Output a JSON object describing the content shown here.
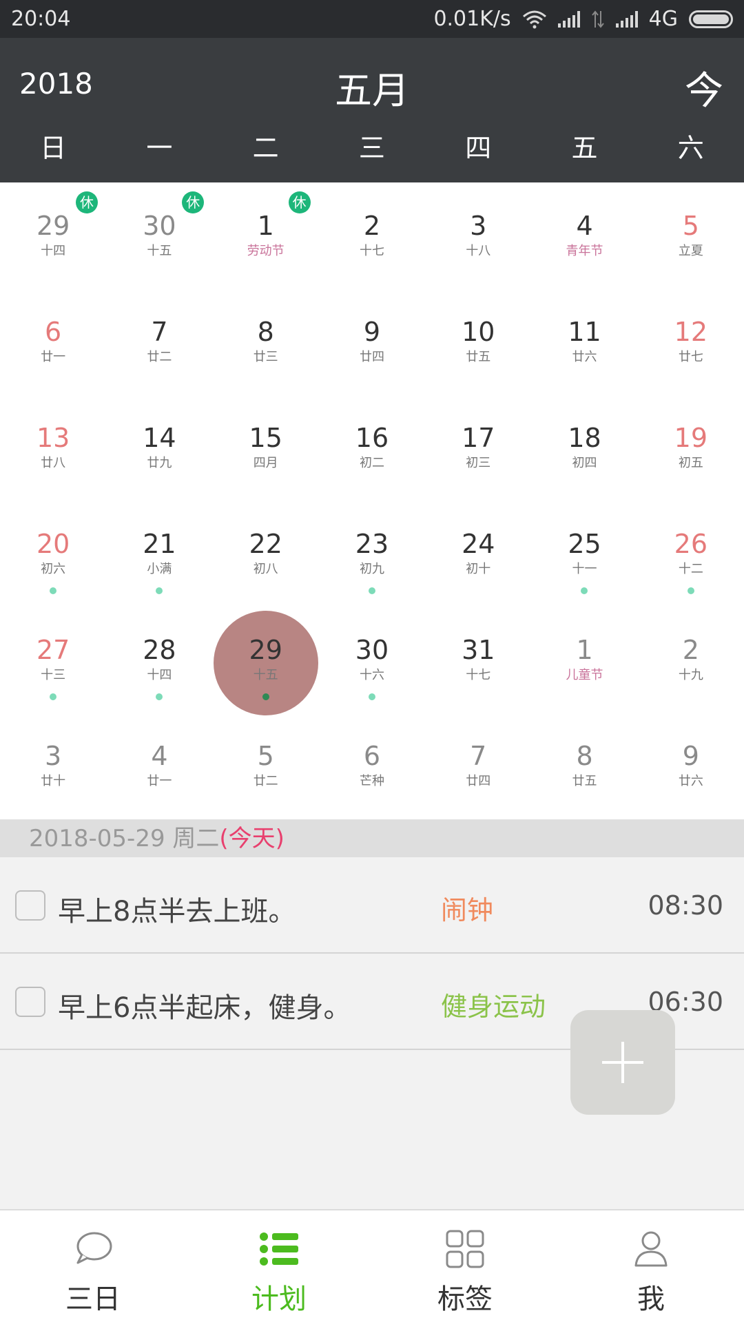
{
  "status_bar": {
    "time": "20:04",
    "speed": "0.01K/s",
    "network": "4G"
  },
  "header": {
    "year": "2018",
    "month": "五月",
    "today_button": "今",
    "weekdays": [
      "日",
      "一",
      "二",
      "三",
      "四",
      "五",
      "六"
    ]
  },
  "rest_label": "休",
  "calendar": [
    [
      {
        "day": "29",
        "lunar": "十四",
        "other": true,
        "rest": true
      },
      {
        "day": "30",
        "lunar": "十五",
        "other": true,
        "rest": true
      },
      {
        "day": "1",
        "lunar": "劳动节",
        "holiday": true,
        "rest": true
      },
      {
        "day": "2",
        "lunar": "十七"
      },
      {
        "day": "3",
        "lunar": "十八"
      },
      {
        "day": "4",
        "lunar": "青年节",
        "holiday": true
      },
      {
        "day": "5",
        "lunar": "立夏",
        "weekend": true
      }
    ],
    [
      {
        "day": "6",
        "lunar": "廿一",
        "weekend": true
      },
      {
        "day": "7",
        "lunar": "廿二"
      },
      {
        "day": "8",
        "lunar": "廿三"
      },
      {
        "day": "9",
        "lunar": "廿四"
      },
      {
        "day": "10",
        "lunar": "廿五"
      },
      {
        "day": "11",
        "lunar": "廿六"
      },
      {
        "day": "12",
        "lunar": "廿七",
        "weekend": true
      }
    ],
    [
      {
        "day": "13",
        "lunar": "廿八",
        "weekend": true
      },
      {
        "day": "14",
        "lunar": "廿九"
      },
      {
        "day": "15",
        "lunar": "四月"
      },
      {
        "day": "16",
        "lunar": "初二"
      },
      {
        "day": "17",
        "lunar": "初三"
      },
      {
        "day": "18",
        "lunar": "初四"
      },
      {
        "day": "19",
        "lunar": "初五",
        "weekend": true
      }
    ],
    [
      {
        "day": "20",
        "lunar": "初六",
        "weekend": true,
        "dot": true
      },
      {
        "day": "21",
        "lunar": "小满",
        "dot": true
      },
      {
        "day": "22",
        "lunar": "初八"
      },
      {
        "day": "23",
        "lunar": "初九",
        "dot": true
      },
      {
        "day": "24",
        "lunar": "初十"
      },
      {
        "day": "25",
        "lunar": "十一",
        "dot": true
      },
      {
        "day": "26",
        "lunar": "十二",
        "weekend": true,
        "dot": true
      }
    ],
    [
      {
        "day": "27",
        "lunar": "十三",
        "weekend": true,
        "dot": true
      },
      {
        "day": "28",
        "lunar": "十四",
        "dot": true
      },
      {
        "day": "29",
        "lunar": "十五",
        "selected": true,
        "dot": true
      },
      {
        "day": "30",
        "lunar": "十六",
        "dot": true
      },
      {
        "day": "31",
        "lunar": "十七"
      },
      {
        "day": "1",
        "lunar": "儿童节",
        "other": true,
        "holiday": true
      },
      {
        "day": "2",
        "lunar": "十九",
        "other": true
      }
    ],
    [
      {
        "day": "3",
        "lunar": "廿十",
        "other": true
      },
      {
        "day": "4",
        "lunar": "廿一",
        "other": true
      },
      {
        "day": "5",
        "lunar": "廿二",
        "other": true
      },
      {
        "day": "6",
        "lunar": "芒种",
        "other": true
      },
      {
        "day": "7",
        "lunar": "廿四",
        "other": true
      },
      {
        "day": "8",
        "lunar": "廿五",
        "other": true
      },
      {
        "day": "9",
        "lunar": "廿六",
        "other": true
      }
    ]
  ],
  "date_bar": {
    "date": "2018-05-29 周二",
    "today_label": "(今天)"
  },
  "tasks": [
    {
      "text": "早上8点半去上班。",
      "tag": "闹钟",
      "tag_color": "#f08a5d",
      "time": "08:30"
    },
    {
      "text": "早上6点半起床，健身。",
      "tag": "健身运动",
      "tag_color": "#8bc34a",
      "time": "06:30"
    }
  ],
  "nav": [
    {
      "label": "三日",
      "icon": "chat-bubble-icon",
      "active": false
    },
    {
      "label": "计划",
      "icon": "list-icon",
      "active": true
    },
    {
      "label": "标签",
      "icon": "grid-icon",
      "active": false
    },
    {
      "label": "我",
      "icon": "person-icon",
      "active": false
    }
  ]
}
